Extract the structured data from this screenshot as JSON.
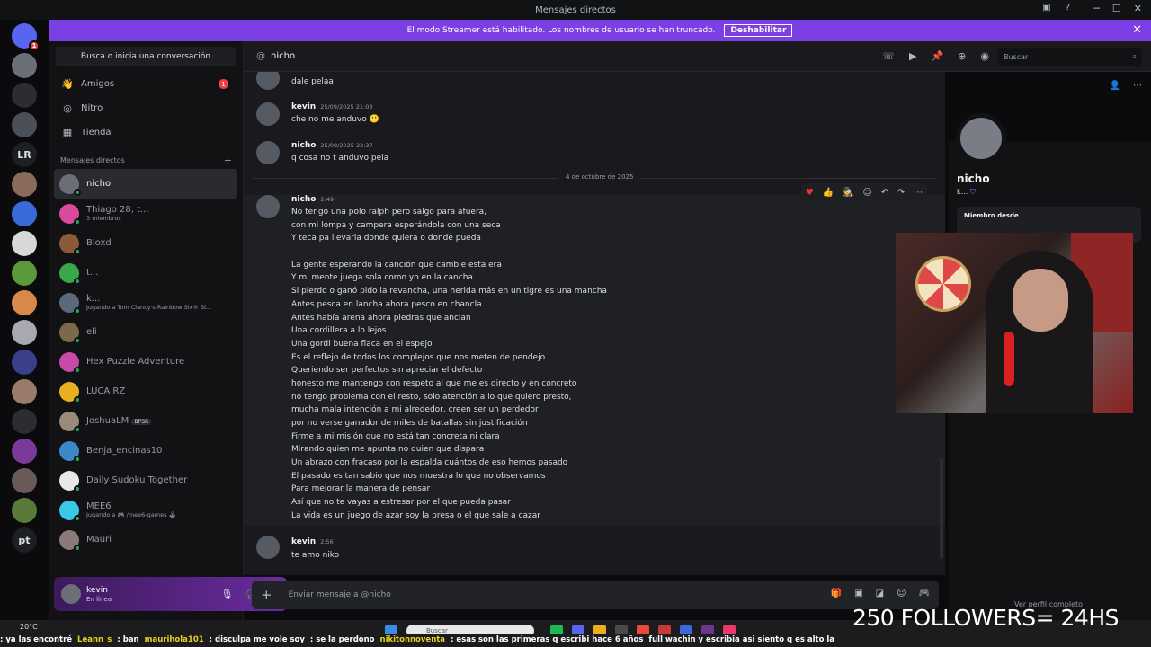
{
  "window": {
    "title": "Mensajes directos"
  },
  "streamer_banner": {
    "text": "El modo Streamer está habilitado. Los nombres de usuario se han truncado.",
    "button": "Deshabilitar"
  },
  "servers": [
    {
      "label": "",
      "color": "#5865f2",
      "badge": "1"
    },
    {
      "label": "",
      "color": "#6b6f78"
    },
    {
      "label": "",
      "color": "#2b2d31"
    },
    {
      "label": "",
      "color": "#4b4f57"
    },
    {
      "label": "LR",
      "color": "#1e1f22"
    },
    {
      "label": "",
      "color": "#8a6a5a"
    },
    {
      "label": "",
      "color": "#3a6ad8"
    },
    {
      "label": "",
      "color": "#d8d8d8"
    },
    {
      "label": "",
      "color": "#5b9a3a"
    },
    {
      "label": "",
      "color": "#d8884a"
    },
    {
      "label": "",
      "color": "#a8a8b0"
    },
    {
      "label": "",
      "color": "#3a3f8a"
    },
    {
      "label": "",
      "color": "#9a7a6a"
    },
    {
      "label": "",
      "color": "#2b2d31"
    },
    {
      "label": "",
      "color": "#7a3a9a"
    },
    {
      "label": "",
      "color": "#6a5a5a"
    },
    {
      "label": "",
      "color": "#5a7a3a"
    },
    {
      "label": "pt",
      "color": "#1e1f22"
    }
  ],
  "sidebar": {
    "search_button": "Busca o inicia una conversación",
    "nav": [
      {
        "label": "Amigos",
        "icon": "👋",
        "badge": "1"
      },
      {
        "label": "Nitro",
        "icon": "◎"
      },
      {
        "label": "Tienda",
        "icon": "▦"
      }
    ],
    "dm_header": "Mensajes directos",
    "dm_add": "+",
    "dms": [
      {
        "name": "nicho",
        "sub": "",
        "color": "#6d6f78"
      },
      {
        "name": "Thiago 28, t...",
        "sub": "3 miembros",
        "color": "#d94a9a"
      },
      {
        "name": "Bloxd",
        "sub": "",
        "color": "#8a5a3a"
      },
      {
        "name": "t...",
        "sub": "",
        "color": "#3aa84a"
      },
      {
        "name": "k...",
        "sub": "Jugando a Tom Clancy's Rainbow Six® Si...",
        "color": "#5a6a7a"
      },
      {
        "name": "eli",
        "sub": "",
        "color": "#7a6a4a"
      },
      {
        "name": "Hex Puzzle Adventure",
        "sub": "",
        "color": "#c84aa8"
      },
      {
        "name": "LUCA RZ",
        "sub": "",
        "color": "#e8b020"
      },
      {
        "name": "JoshuaLM",
        "sub": "",
        "color": "#9a8a7a",
        "tag": "BPSR"
      },
      {
        "name": "Benja_encinas10",
        "sub": "",
        "color": "#3a88c8"
      },
      {
        "name": "Daily Sudoku Together",
        "sub": "",
        "color": "#e8e8e8"
      },
      {
        "name": "MEE6",
        "sub": "Jugando a 🎮 /mee6-games 🕹",
        "color": "#3ac8e8"
      },
      {
        "name": "Mauri",
        "sub": "",
        "color": "#8a7a7a"
      }
    ],
    "user": {
      "name": "kevin",
      "status": "En línea"
    }
  },
  "chat": {
    "channel": "nicho",
    "search_placeholder": "Buscar",
    "date_divider": "4 de octubre de 2025",
    "messages": [
      {
        "text": "dale pelaa"
      },
      {
        "author": "kevin",
        "time": "25/09/2025 21:03",
        "text": "che no me anduvo 🙁"
      },
      {
        "author": "nicho",
        "time": "25/09/2025 22:37",
        "text": "q cosa no t anduvo pela"
      },
      {
        "author": "nicho",
        "time": "2:49",
        "lines": [
          "No tengo una polo ralph pero salgo para afuera,",
          "con mi lompa y campera esperándola con una seca",
          "Y teca pa llevarla donde quiera o donde pueda",
          "",
          "La gente esperando la canción que cambie esta era",
          "Y mi mente juega sola como yo en la cancha",
          "Si pierdo o ganó pido la revancha, una herida más en un tigre es una mancha",
          "Antes pesca en lancha ahora pesco en chancla",
          "Antes había arena ahora piedras que anclan",
          "Una cordillera a lo lejos",
          "Una gordi buena flaca en el espejo",
          "Es el reflejo de todos los complejos que nos meten de pendejo",
          "Queriendo ser perfectos sin apreciar el defecto",
          "honesto me mantengo con respeto al que me es directo y en concreto",
          "no tengo problema con el resto, solo atención a lo que quiero presto,",
          "mucha mala intención a mi alrededor, creen ser un perdedor",
          "por no verse ganador de miles de batallas sin justificación",
          "Firme a mi misión que no está tan concreta ni clara",
          "Mirando quien me apunta no quien que dispara",
          "Un abrazo con fracaso por la espalda cuántos de eso hemos pasado",
          "El pasado es tan sabio que nos muestra lo que no observamos",
          "Para mejorar la manera de pensar",
          "Así que no te vayas a estresar por el que pueda pasar",
          "La vida es un juego de azar soy la presa o el que sale a cazar"
        ]
      },
      {
        "author": "kevin",
        "time": "2:56",
        "text": "te amo niko"
      }
    ],
    "composer_placeholder": "Enviar mensaje a @nicho"
  },
  "profile": {
    "name": "nicho",
    "tag": "k...",
    "member_since_label": "Miembro desde",
    "view_full": "Ver perfil completo"
  },
  "taskbar": {
    "weather": "20°C",
    "search": "Buscar"
  },
  "overlay": {
    "followers": "250 FOLLOWERS= 24HS"
  },
  "ticker": [
    {
      "text": ": ya las encontré",
      "color": "#ffffff"
    },
    {
      "text": "Leann_s",
      "color": "#e8d020"
    },
    {
      "text": ": ban",
      "color": "#ffffff"
    },
    {
      "text": "maurihola101",
      "color": "#e8d020"
    },
    {
      "text": ": disculpa  me vole  soy",
      "color": "#ffffff"
    },
    {
      "text": ": se la perdono",
      "color": "#ffffff"
    },
    {
      "text": "nikitonnoventa",
      "color": "#e8d020"
    },
    {
      "text": ": esas son las primeras q escribi hace 6 años",
      "color": "#ffffff"
    },
    {
      "text": "full wachin y escribia asi siento q es alto la",
      "color": "#ffffff"
    }
  ]
}
